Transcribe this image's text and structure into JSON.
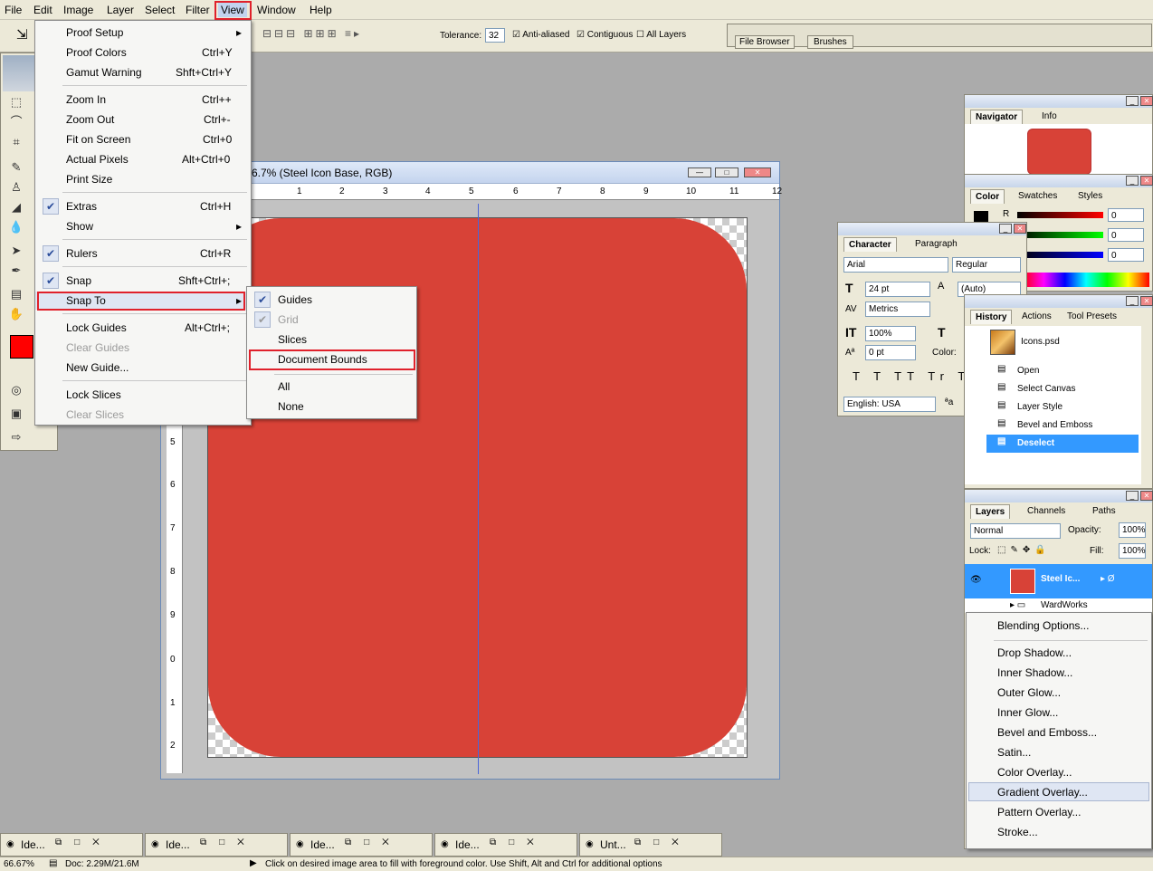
{
  "menubar": {
    "items": [
      "File",
      "Edit",
      "Image",
      "Layer",
      "Select",
      "Filter",
      "View",
      "Window",
      "Help"
    ],
    "active": "View"
  },
  "options": {
    "tolerance_label": "Tolerance:",
    "tolerance_value": "32",
    "antialiased": "Anti-aliased",
    "contiguous": "Contiguous",
    "all_layers": "All Layers",
    "file_browser": "File Browser",
    "brushes": "Brushes"
  },
  "view_menu": [
    {
      "label": "Proof Setup",
      "shortcut": "",
      "submenu": true
    },
    {
      "label": "Proof Colors",
      "shortcut": "Ctrl+Y"
    },
    {
      "label": "Gamut Warning",
      "shortcut": "Shft+Ctrl+Y"
    },
    {
      "label": "Zoom In",
      "shortcut": "Ctrl++"
    },
    {
      "label": "Zoom Out",
      "shortcut": "Ctrl+-"
    },
    {
      "label": "Fit on Screen",
      "shortcut": "Ctrl+0"
    },
    {
      "label": "Actual Pixels",
      "shortcut": "Alt+Ctrl+0"
    },
    {
      "label": "Print Size",
      "shortcut": ""
    },
    {
      "label": "Extras",
      "shortcut": "Ctrl+H",
      "checked": true
    },
    {
      "label": "Show",
      "shortcut": "",
      "submenu": true
    },
    {
      "label": "Rulers",
      "shortcut": "Ctrl+R",
      "checked": true
    },
    {
      "label": "Snap",
      "shortcut": "Shft+Ctrl+;",
      "checked": true
    },
    {
      "label": "Snap To",
      "shortcut": "",
      "submenu": true,
      "highlighted": true
    },
    {
      "label": "Lock Guides",
      "shortcut": "Alt+Ctrl+;"
    },
    {
      "label": "Clear Guides",
      "shortcut": "",
      "disabled": true
    },
    {
      "label": "New Guide...",
      "shortcut": ""
    },
    {
      "label": "Lock Slices",
      "shortcut": ""
    },
    {
      "label": "Clear Slices",
      "shortcut": "",
      "disabled": true
    }
  ],
  "snap_menu": [
    {
      "label": "Guides",
      "checked": true
    },
    {
      "label": "Grid",
      "checked": true,
      "disabled": true
    },
    {
      "label": "Slices"
    },
    {
      "label": "Document Bounds",
      "highlighted": true
    },
    {
      "label": "All"
    },
    {
      "label": "None"
    }
  ],
  "document": {
    "title": "6.7% (Steel Icon Base, RGB)",
    "fill_color": "#d84237",
    "ruler_top": [
      "1",
      "2",
      "3",
      "4",
      "5",
      "6",
      "7",
      "8",
      "9",
      "10",
      "11",
      "12"
    ],
    "ruler_left": [
      "5",
      "6",
      "7",
      "8",
      "9",
      "0",
      "1",
      "2"
    ]
  },
  "navigator": {
    "tabs": [
      "Navigator",
      "Info"
    ],
    "thumb_color": "#d84237"
  },
  "color_panel": {
    "tabs": [
      "Color",
      "Swatches",
      "Styles"
    ],
    "channels": [
      {
        "label": "R",
        "value": "0"
      },
      {
        "label": "",
        "value": "0"
      },
      {
        "label": "",
        "value": "0"
      }
    ]
  },
  "character": {
    "tabs": [
      "Character",
      "Paragraph"
    ],
    "font": "Arial",
    "style": "Regular",
    "size": "24 pt",
    "leading": "(Auto)",
    "kerning": "Metrics",
    "scale": "100%",
    "baseline": "0 pt",
    "color_label": "Color:",
    "language": "English: USA"
  },
  "history": {
    "tabs": [
      "History",
      "Actions",
      "Tool Presets"
    ],
    "snapshot": "Icons.psd",
    "steps": [
      "Open",
      "Select Canvas",
      "Layer Style",
      "Bevel and Emboss",
      "Deselect"
    ],
    "active": "Deselect"
  },
  "layers": {
    "tabs": [
      "Layers",
      "Channels",
      "Paths"
    ],
    "blend_mode": "Normal",
    "opacity_label": "Opacity:",
    "opacity": "100%",
    "lock_label": "Lock:",
    "fill_label": "Fill:",
    "fill": "100%",
    "active_layer": "Steel Ic...",
    "group": "WardWorks"
  },
  "context_menu": [
    "Blending Options...",
    "Drop Shadow...",
    "Inner Shadow...",
    "Outer Glow...",
    "Inner Glow...",
    "Bevel and Emboss...",
    "Satin...",
    "Color Overlay...",
    "Gradient Overlay...",
    "Pattern Overlay...",
    "Stroke..."
  ],
  "taskbar": [
    "Ide...",
    "Ide...",
    "Ide...",
    "Ide...",
    "Unt..."
  ],
  "status": {
    "zoom": "66.67%",
    "doc": "Doc: 2.29M/21.6M",
    "hint": "Click on desired image area to fill with foreground color.  Use Shift, Alt and Ctrl for additional options"
  },
  "colors": {
    "foreground": "#ff0000",
    "highlight": "#3399ff",
    "red_annotation": "#e0212b"
  }
}
